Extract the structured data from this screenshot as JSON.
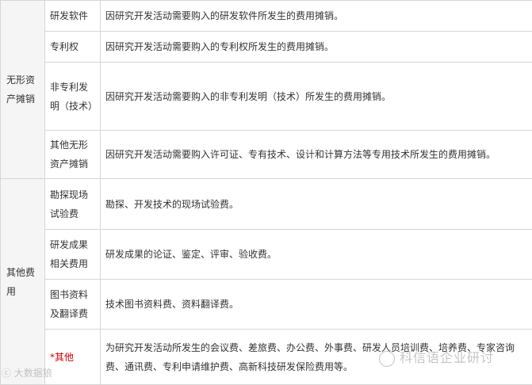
{
  "groups": [
    {
      "category": "无形资产摊销",
      "rows": [
        {
          "item": "研发软件",
          "desc": "因研究开发活动需要购入的研发软件所发生的费用摊销。"
        },
        {
          "item": "专利权",
          "desc": "因研究开发活动需要购入的专利权所发生的费用摊销。"
        },
        {
          "item": "非专利发明（技术）",
          "desc": "因研究开发活动需要购入的非专利发明（技术）所发生的费用摊销。"
        },
        {
          "item": "其他无形资产摊销",
          "desc": "因研究开发活动需要购入许可证、专有技术、设计和计算方法等专用技术所发生的费用摊销。"
        }
      ]
    },
    {
      "category": "其他费用",
      "rows": [
        {
          "item": "勘探现场试验费",
          "desc": "勘探、开发技术的现场试验费。"
        },
        {
          "item": "研发成果相关费用",
          "desc": "研发成果的论证、鉴定、评审、验收费。"
        },
        {
          "item": "图书资料及翻译费",
          "desc": "技术图书资料费、资料翻译费。"
        },
        {
          "item": "*其他",
          "desc": "为研究开发活动所发生的会议费、差旅费、办公费、外事费、研发人员培训费、培养费、专家咨询费、通讯费、专利申请维护费、高新科技研发保险费用等。"
        }
      ]
    }
  ],
  "watermarks": {
    "left": "大数据狼",
    "right": "科信语企业研讨"
  },
  "colors": {
    "border": "#d6d6d6",
    "category_bg": "#f5f5f5",
    "text": "#333333",
    "highlight": "#cc0000"
  }
}
